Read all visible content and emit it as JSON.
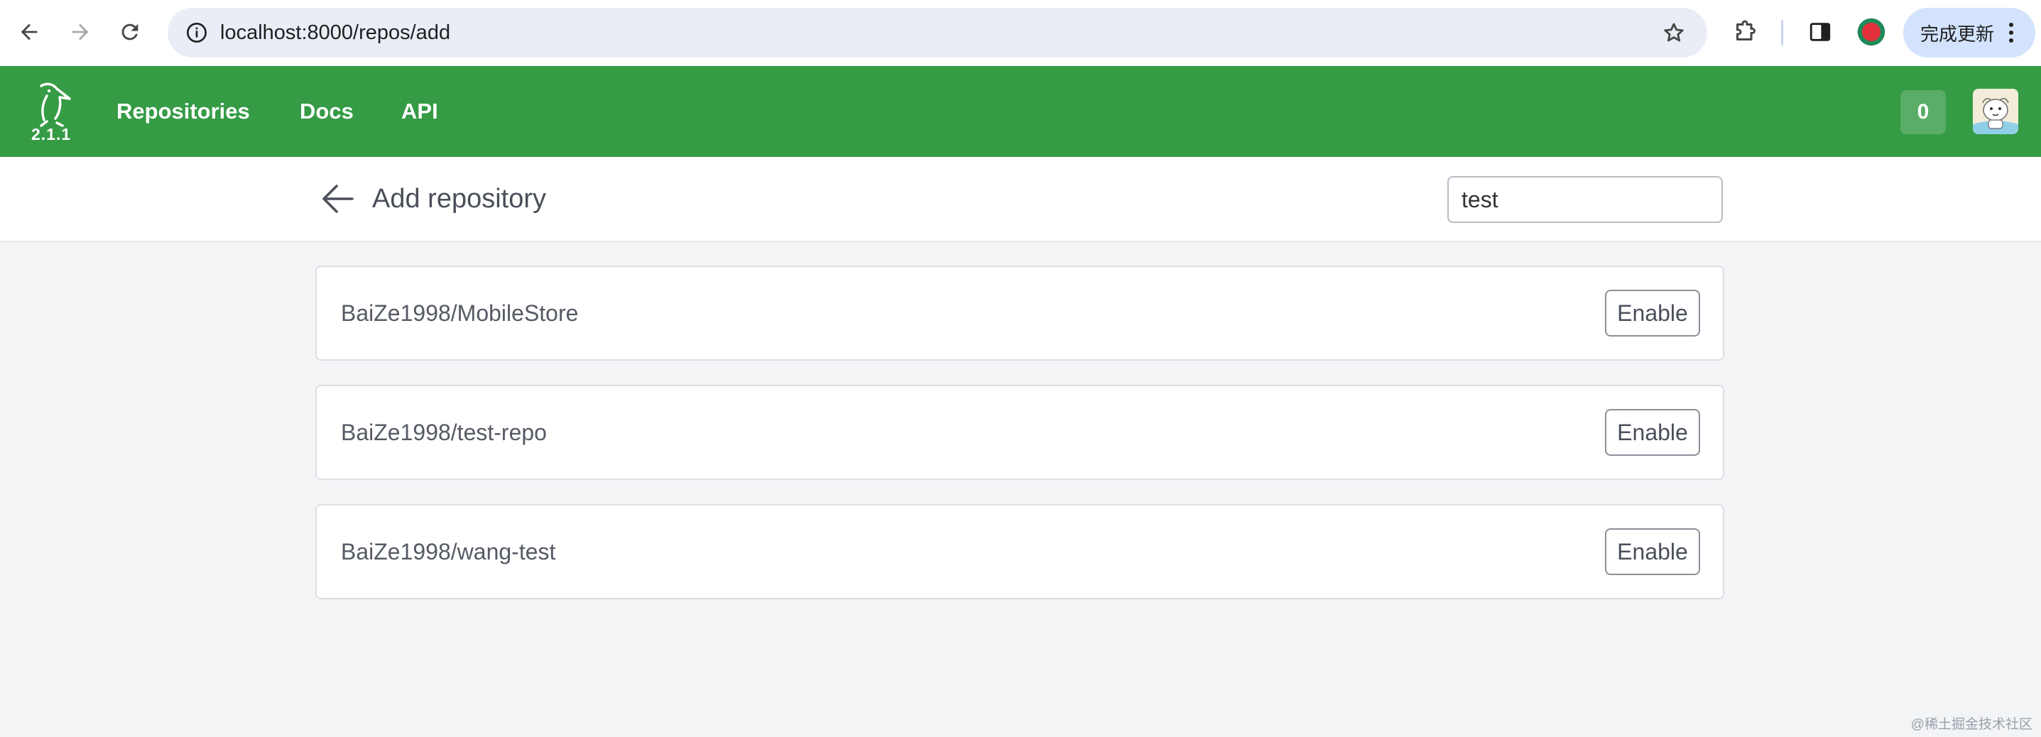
{
  "browser": {
    "url": "localhost:8000/repos/add",
    "update_button_label": "完成更新"
  },
  "app": {
    "version": "2.1.1",
    "nav": [
      {
        "label": "Repositories"
      },
      {
        "label": "Docs"
      },
      {
        "label": "API"
      }
    ],
    "badge_count": "0",
    "brand_color": "#359b45"
  },
  "page": {
    "title": "Add repository",
    "search": {
      "value": "test",
      "placeholder": ""
    }
  },
  "repos": [
    {
      "name": "BaiZe1998/MobileStore",
      "action": "Enable"
    },
    {
      "name": "BaiZe1998/test-repo",
      "action": "Enable"
    },
    {
      "name": "BaiZe1998/wang-test",
      "action": "Enable"
    }
  ],
  "watermark": "@稀土掘金技术社区"
}
